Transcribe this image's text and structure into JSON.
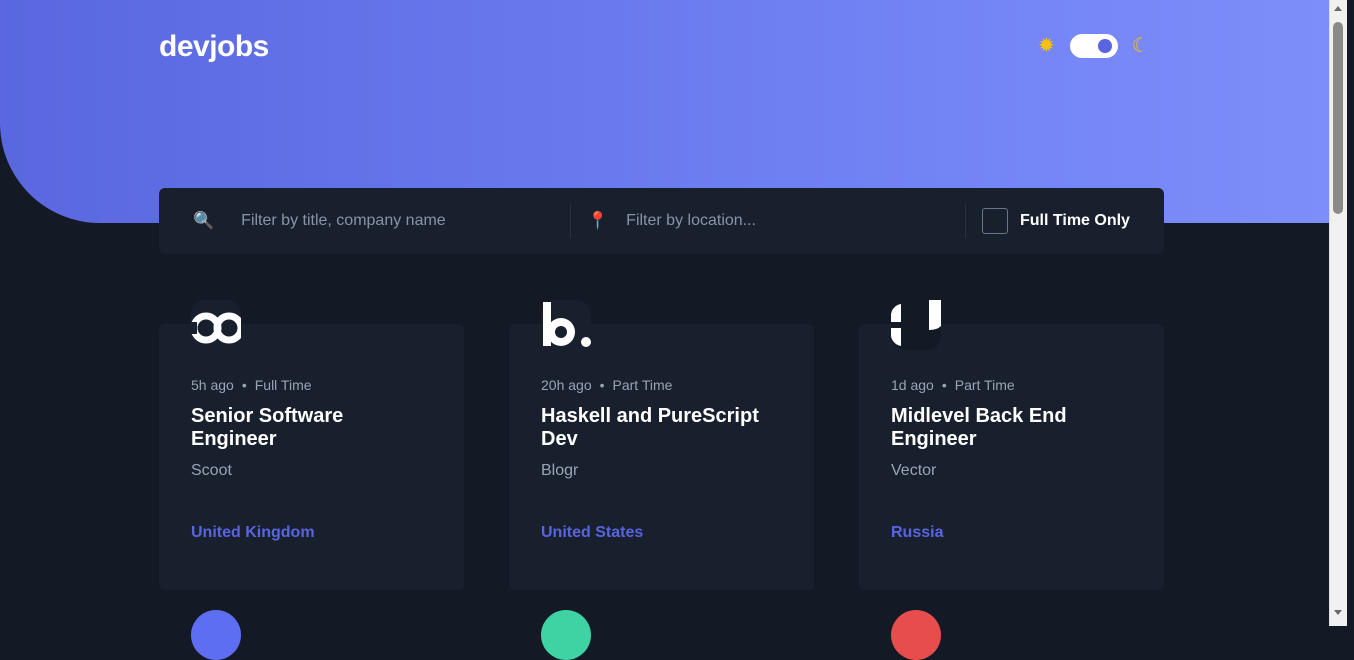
{
  "header": {
    "logo": "devjobs",
    "theme_toggle": {
      "sun_icon": "sun-icon",
      "moon_icon": "moon-icon",
      "dark_mode": true
    }
  },
  "filter": {
    "title_placeholder": "Filter by title, company name",
    "location_placeholder": "Filter by location...",
    "fulltime_label": "Full Time Only"
  },
  "jobs": [
    {
      "posted": "5h ago",
      "contract": "Full Time",
      "title": "Senior Software Engineer",
      "company": "Scoot",
      "location": "United Kingdom",
      "logo_color": "#19202d",
      "logo_text": "cod"
    },
    {
      "posted": "20h ago",
      "contract": "Part Time",
      "title": "Haskell and PureScript Dev",
      "company": "Blogr",
      "location": "United States",
      "logo_color": "#19202d",
      "logo_text": "b."
    },
    {
      "posted": "1d ago",
      "contract": "Part Time",
      "title": "Midlevel Back End Engineer",
      "company": "Vector",
      "location": "Russia",
      "logo_color": "#141a25",
      "logo_text": ""
    }
  ],
  "next_row_logo_colors": [
    "#5e6ef2",
    "#3fd3a3",
    "#e84d4d"
  ],
  "colors": {
    "accent": "#5964e0",
    "background": "#141a25",
    "card": "#19202d"
  }
}
